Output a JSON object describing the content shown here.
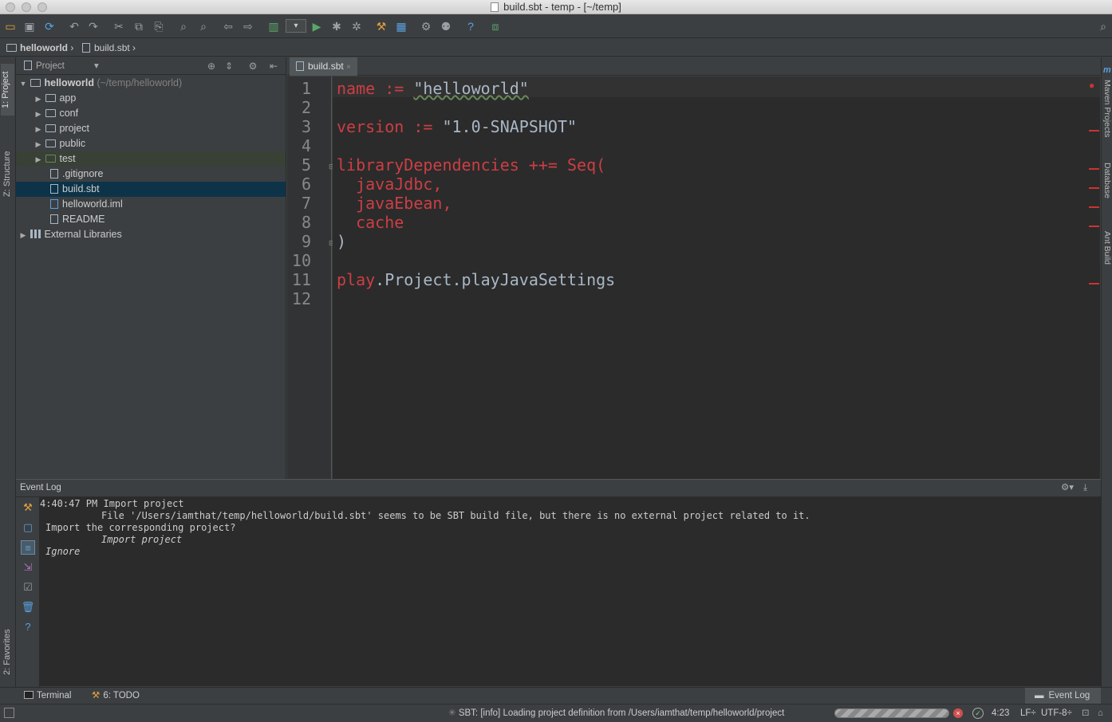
{
  "window": {
    "title": "build.sbt - temp - [~/temp]"
  },
  "navbar": {
    "crumb_project": "helloworld",
    "crumb_file": "build.sbt"
  },
  "left_stripe": {
    "project_tab": "1: Project",
    "structure_tab": "Z: Structure",
    "favorites_tab": "2: Favorites"
  },
  "project_panel": {
    "view_selector": "Project",
    "tree": [
      {
        "label": "helloworld",
        "suffix": "(~/temp/helloworld)",
        "type": "folder",
        "expanded": true
      },
      {
        "label": "app",
        "type": "folder"
      },
      {
        "label": "conf",
        "type": "folder"
      },
      {
        "label": "project",
        "type": "folder"
      },
      {
        "label": "public",
        "type": "folder"
      },
      {
        "label": "test",
        "type": "folder"
      },
      {
        "label": ".gitignore",
        "type": "file"
      },
      {
        "label": "build.sbt",
        "type": "file",
        "selected": true
      },
      {
        "label": "helloworld.iml",
        "type": "file"
      },
      {
        "label": "README",
        "type": "file"
      },
      {
        "label": "External Libraries",
        "type": "library"
      }
    ]
  },
  "editor": {
    "tab_label": "build.sbt",
    "line_numbers": [
      "1",
      "2",
      "3",
      "4",
      "5",
      "6",
      "7",
      "8",
      "9",
      "10",
      "11",
      "12"
    ],
    "lines": {
      "l1_key": "name := ",
      "l1_val": "\"helloworld\"",
      "l3_key": "version := ",
      "l3_val": "\"1.0-SNAPSHOT\"",
      "l5": "libraryDependencies ++= Seq(",
      "l6": "  javaJdbc,",
      "l7": "  javaEbean,",
      "l8": "  cache",
      "l9": ")",
      "l11_a": "play",
      "l11_b": ".Project.playJavaSettings"
    }
  },
  "right_stripe": {
    "maven": "Maven Projects",
    "database": "Database",
    "ant": "Ant Build"
  },
  "event_log": {
    "title": "Event Log",
    "time": "4:40:47 PM",
    "line1": " Import project",
    "line2": "File '/Users/iamthat/temp/helloworld/build.sbt' seems to be SBT build file, but there is no external project related to it.",
    "line3": "Import the corresponding project?",
    "link_import": "Import project",
    "link_ignore": "Ignore"
  },
  "bottom_tabs": {
    "terminal": "Terminal",
    "todo": "6: TODO",
    "event_log": "Event Log"
  },
  "status": {
    "message": "SBT: [info] Loading project definition from /Users/iamthat/temp/helloworld/project",
    "position": "4:23",
    "line_sep": "LF÷",
    "encoding": "UTF-8÷"
  },
  "colors": {
    "keyword": "#cc3e44",
    "selection": "#0d3349",
    "editor_bg": "#2b2b2b",
    "panel_bg": "#3c3f41"
  }
}
